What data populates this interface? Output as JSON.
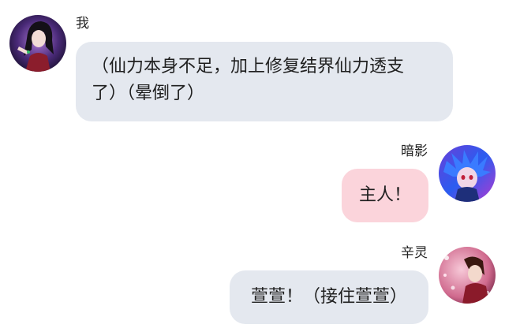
{
  "messages": [
    {
      "sender": "我",
      "side": "left",
      "text_line1": "（仙力本身不足，加上修复结界仙力透支",
      "text_line2": "了）（晕倒了）",
      "bubble_color": "#e4e8ef",
      "avatar": "character-avatar-dark-hair"
    },
    {
      "sender": "暗影",
      "side": "right",
      "text": "主人！",
      "bubble_color": "#fbd4db",
      "avatar": "character-avatar-blue-hair"
    },
    {
      "sender": "辛灵",
      "side": "right",
      "text": "萱萱！（接住萱萱）",
      "bubble_color": "#e4e8ef",
      "avatar": "character-avatar-pink-sparkle"
    }
  ]
}
